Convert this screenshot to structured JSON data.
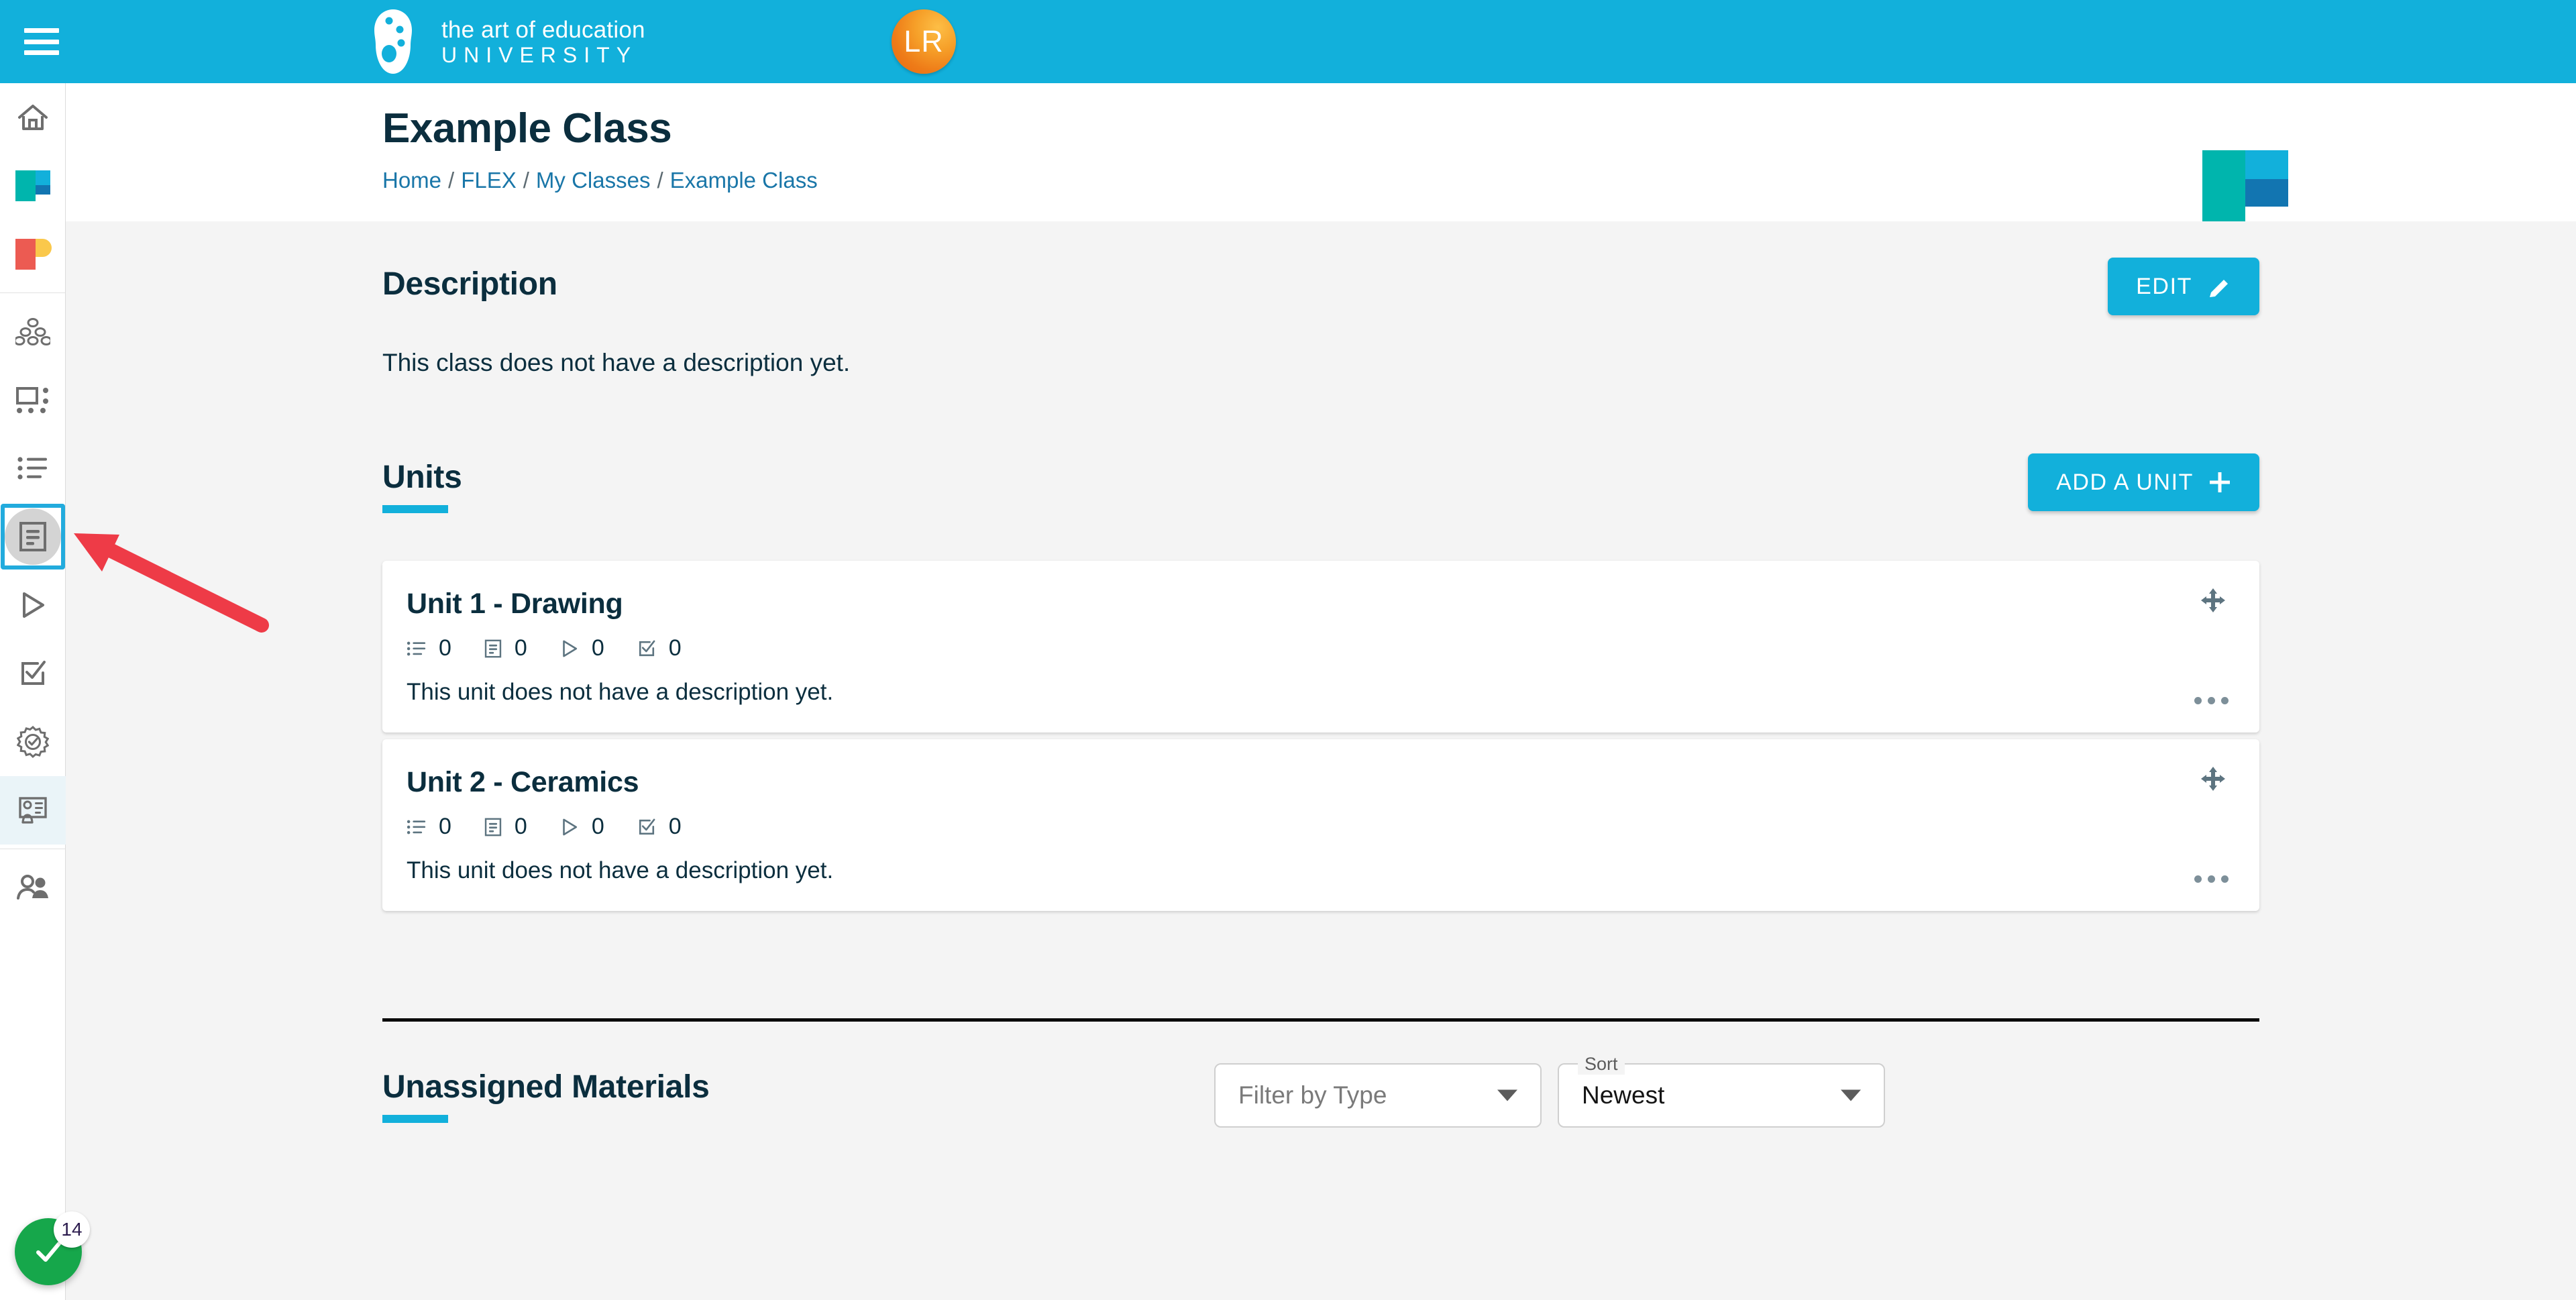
{
  "topbar": {
    "menu_icon": "hamburger-menu-icon",
    "brand_line1": "the art of education",
    "brand_line2": "UNIVERSITY",
    "avatar_initials": "LR",
    "bg_color": "#12B0DB"
  },
  "sidebar": {
    "items": [
      {
        "icon": "home-icon",
        "name": "home",
        "selected": false,
        "tinted": false
      },
      {
        "icon": "flex-logo-icon",
        "name": "flex",
        "selected": false,
        "tinted": false
      },
      {
        "icon": "pro-logo-icon",
        "name": "pro",
        "selected": false,
        "tinted": false
      },
      {
        "icon": "community-group-icon",
        "name": "community",
        "selected": false,
        "tinted": false
      },
      {
        "icon": "layout-grid-icon",
        "name": "layout",
        "selected": false,
        "tinted": false
      },
      {
        "icon": "list-bullets-icon",
        "name": "list",
        "selected": false,
        "tinted": false
      },
      {
        "icon": "document-lines-icon",
        "name": "classes",
        "selected": true,
        "tinted": false
      },
      {
        "icon": "play-triangle-icon",
        "name": "videos",
        "selected": false,
        "tinted": false
      },
      {
        "icon": "checkbox-edit-icon",
        "name": "assessments",
        "selected": false,
        "tinted": false
      },
      {
        "icon": "award-badge-icon",
        "name": "standards",
        "selected": false,
        "tinted": false
      },
      {
        "icon": "presentation-card-icon",
        "name": "presentations",
        "selected": false,
        "tinted": true
      },
      {
        "icon": "people-icon",
        "name": "students",
        "selected": false,
        "tinted": false
      }
    ]
  },
  "header": {
    "title": "Example Class",
    "breadcrumb": [
      {
        "label": "Home",
        "link": true
      },
      {
        "label": "FLEX",
        "link": true
      },
      {
        "label": "My Classes",
        "link": true
      },
      {
        "label": "Example Class",
        "link": true
      }
    ],
    "separator": "/",
    "logo": "flex-mark-icon"
  },
  "description": {
    "heading": "Description",
    "text": "This class does not have a description yet.",
    "edit_label": "EDIT",
    "edit_icon": "pencil-icon"
  },
  "units": {
    "heading": "Units",
    "add_label": "ADD A UNIT",
    "add_icon": "plus-icon",
    "metric_icons": [
      "list-bullets-icon",
      "document-lines-icon",
      "play-triangle-icon",
      "checkbox-check-icon"
    ],
    "move_icon": "move-arrows-icon",
    "more_icon": "more-dots-icon",
    "cards": [
      {
        "title": "Unit 1 - Drawing",
        "description": "This unit does not have a description yet.",
        "counts": [
          "0",
          "0",
          "0",
          "0"
        ]
      },
      {
        "title": "Unit 2 - Ceramics",
        "description": "This unit does not have a description yet.",
        "counts": [
          "0",
          "0",
          "0",
          "0"
        ]
      }
    ]
  },
  "unassigned": {
    "heading": "Unassigned Materials",
    "filter": {
      "placeholder": "Filter by Type",
      "value": "",
      "caret_icon": "chevron-down-icon"
    },
    "sort": {
      "label": "Sort",
      "value": "Newest",
      "caret_icon": "chevron-down-icon"
    }
  },
  "fab": {
    "icon": "check-icon",
    "badge": "14",
    "color": "#16A74B"
  },
  "annotation": {
    "arrow_color": "#EE3B47",
    "highlight_color": "#22ABDD"
  }
}
